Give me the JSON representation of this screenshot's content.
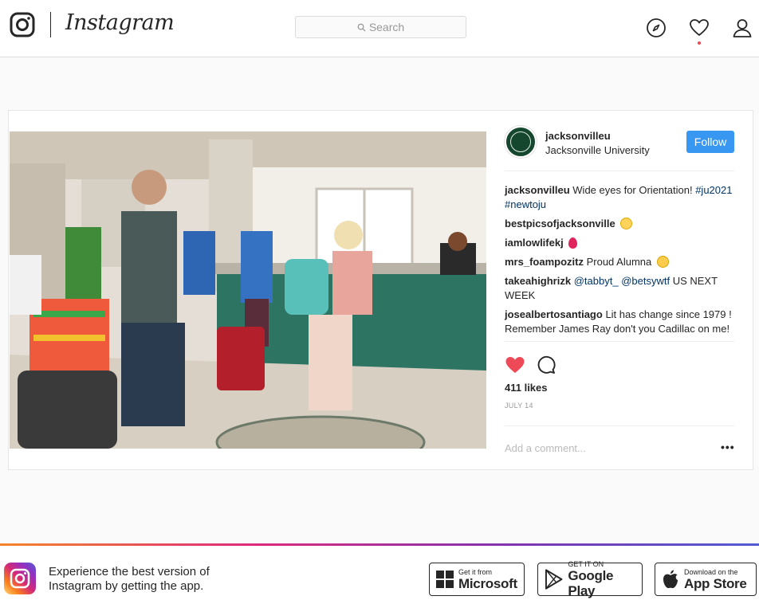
{
  "header": {
    "wordmark": "Instagram",
    "search_placeholder": "Search"
  },
  "post": {
    "username": "jacksonvilleu",
    "location": "Jacksonville University",
    "follow_label": "Follow",
    "caption": {
      "user": "jacksonvilleu",
      "text": "Wide eyes for Orientation!",
      "hashtags": [
        "#ju2021",
        "#newtoju"
      ]
    },
    "comments": [
      {
        "user": "bestpicsofjacksonville",
        "text": "",
        "emoji": "baby-emoji"
      },
      {
        "user": "iamlowlifekj",
        "text": "",
        "emoji": "balloon-emoji"
      },
      {
        "user": "mrs_foampozitz",
        "text": "Proud Alumna",
        "emoji": "smile-emoji"
      },
      {
        "user": "takeahighrizk",
        "mentions": [
          "@tabbyt_",
          "@betsywtf"
        ],
        "text": "US NEXT WEEK"
      },
      {
        "user": "josealbertosantiago",
        "text": "Lit has change since 1979 ! Remember James Ray don't you Cadillac on me!"
      }
    ],
    "likes": "411 likes",
    "date": "JULY 14",
    "add_comment_placeholder": "Add a comment...",
    "more_label": "•••",
    "liked": true,
    "colors": {
      "accent": "#3897f0",
      "heart": "#ed4956",
      "link": "#003569"
    }
  },
  "banner": {
    "text": "Experience the best version of Instagram by getting the app.",
    "stores": [
      {
        "small": "Get it from",
        "big": "Microsoft"
      },
      {
        "small": "GET IT ON",
        "big": "Google Play"
      },
      {
        "small": "Download on the",
        "big": "App Store"
      }
    ]
  }
}
